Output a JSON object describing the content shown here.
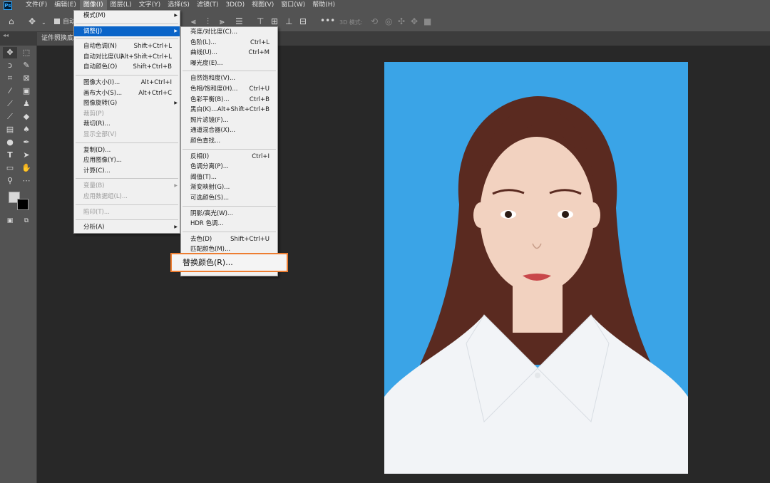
{
  "menubar": {
    "logo": "Ps",
    "items": [
      "文件(F)",
      "编辑(E)",
      "图像(I)",
      "图层(L)",
      "文字(Y)",
      "选择(S)",
      "滤镜(T)",
      "3D(D)",
      "视图(V)",
      "窗口(W)",
      "帮助(H)"
    ]
  },
  "options": {
    "auto_select_label": "自动",
    "mode_3d_label": "3D 模式:",
    "more_label": "•••"
  },
  "document": {
    "tab_title": "证件照换底",
    "collapse_mark": "◂◂"
  },
  "image_menu": {
    "items": [
      {
        "label": "模式(M)",
        "shortcut": "",
        "submenu": true
      },
      {
        "sep": true
      },
      {
        "label": "调整(J)",
        "shortcut": "",
        "submenu": true,
        "highlighted": true
      },
      {
        "sep": true
      },
      {
        "label": "自动色调(N)",
        "shortcut": "Shift+Ctrl+L"
      },
      {
        "label": "自动对比度(U)",
        "shortcut": "Alt+Shift+Ctrl+L"
      },
      {
        "label": "自动颜色(O)",
        "shortcut": "Shift+Ctrl+B"
      },
      {
        "sep": true
      },
      {
        "label": "图像大小(I)...",
        "shortcut": "Alt+Ctrl+I"
      },
      {
        "label": "画布大小(S)...",
        "shortcut": "Alt+Ctrl+C"
      },
      {
        "label": "图像旋转(G)",
        "shortcut": "",
        "submenu": true
      },
      {
        "label": "裁剪(P)",
        "shortcut": "",
        "disabled": true
      },
      {
        "label": "裁切(R)...",
        "shortcut": ""
      },
      {
        "label": "显示全部(V)",
        "shortcut": "",
        "disabled": true
      },
      {
        "sep": true
      },
      {
        "label": "复制(D)...",
        "shortcut": ""
      },
      {
        "label": "应用图像(Y)...",
        "shortcut": ""
      },
      {
        "label": "计算(C)...",
        "shortcut": ""
      },
      {
        "sep": true
      },
      {
        "label": "变量(B)",
        "shortcut": "",
        "submenu": true,
        "disabled": true
      },
      {
        "label": "应用数据组(L)...",
        "shortcut": "",
        "disabled": true
      },
      {
        "sep": true
      },
      {
        "label": "陷印(T)...",
        "shortcut": "",
        "disabled": true
      },
      {
        "sep": true
      },
      {
        "label": "分析(A)",
        "shortcut": "",
        "submenu": true
      }
    ]
  },
  "adjust_menu": {
    "items": [
      {
        "label": "亮度/对比度(C)...",
        "shortcut": ""
      },
      {
        "label": "色阶(L)...",
        "shortcut": "Ctrl+L"
      },
      {
        "label": "曲线(U)...",
        "shortcut": "Ctrl+M"
      },
      {
        "label": "曝光度(E)...",
        "shortcut": ""
      },
      {
        "sep": true
      },
      {
        "label": "自然饱和度(V)...",
        "shortcut": ""
      },
      {
        "label": "色相/饱和度(H)...",
        "shortcut": "Ctrl+U"
      },
      {
        "label": "色彩平衡(B)...",
        "shortcut": "Ctrl+B"
      },
      {
        "label": "黑白(K)...",
        "shortcut": "Alt+Shift+Ctrl+B"
      },
      {
        "label": "照片滤镜(F)...",
        "shortcut": ""
      },
      {
        "label": "通道混合器(X)...",
        "shortcut": ""
      },
      {
        "label": "颜色查找...",
        "shortcut": ""
      },
      {
        "sep": true
      },
      {
        "label": "反相(I)",
        "shortcut": "Ctrl+I"
      },
      {
        "label": "色调分离(P)...",
        "shortcut": ""
      },
      {
        "label": "阈值(T)...",
        "shortcut": ""
      },
      {
        "label": "渐变映射(G)...",
        "shortcut": ""
      },
      {
        "label": "可选颜色(S)...",
        "shortcut": ""
      },
      {
        "sep": true
      },
      {
        "label": "阴影/高光(W)...",
        "shortcut": ""
      },
      {
        "label": "HDR 色调...",
        "shortcut": ""
      },
      {
        "sep": true
      },
      {
        "label": "去色(D)",
        "shortcut": "Shift+Ctrl+U"
      },
      {
        "label": "匹配颜色(M)...",
        "shortcut": ""
      },
      {
        "label": "替换颜色(R)...",
        "shortcut": ""
      },
      {
        "label": "色调均化(Q)",
        "shortcut": ""
      }
    ]
  },
  "callout": {
    "label": "替换颜色(R)..."
  },
  "photo": {
    "background_color": "#3aa4e7",
    "shirt_color": "#f2f4f7",
    "hair_color": "#5a2a20",
    "skin_color": "#f2d2c0"
  }
}
